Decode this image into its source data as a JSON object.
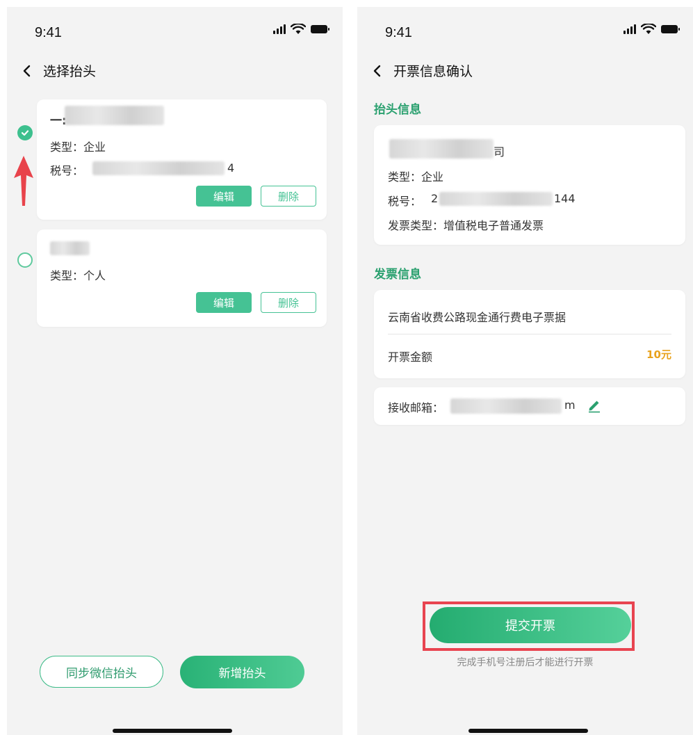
{
  "left": {
    "status": {
      "time": "9:41"
    },
    "title": "选择抬头",
    "cards": [
      {
        "name": "一:",
        "type_line": "类型：企业",
        "tax_prefix": "税号：",
        "tax_suffix": "4",
        "edit_label": "编辑",
        "delete_label": "删除",
        "selected": true
      },
      {
        "type_line": "类型：个人",
        "edit_label": "编辑",
        "delete_label": "删除",
        "selected": false
      }
    ],
    "sync_button": "同步微信抬头",
    "add_button": "新增抬头"
  },
  "right": {
    "status": {
      "time": "9:41"
    },
    "title": "开票信息确认",
    "header_section": "抬头信息",
    "header_card": {
      "name_suffix": "司",
      "type_line": "类型：企业",
      "tax_prefix": "税号：",
      "tax_first": "2",
      "tax_suffix": "144",
      "invoice_type": "发票类型：增值税电子普通发票"
    },
    "invoice_section": "发票信息",
    "invoice_card": {
      "item": "云南省收费公路现金通行费电子票据",
      "amount_label": "开票金额",
      "amount_value": "10元"
    },
    "email": {
      "label": "接收邮箱：",
      "suffix": "m"
    },
    "submit_button": "提交开票",
    "submit_hint": "完成手机号注册后才能进行开票"
  },
  "colors": {
    "accent": "#3dc08e",
    "amount": "#e8a21d",
    "highlight": "#e84450",
    "arrow": "#e8434b"
  }
}
